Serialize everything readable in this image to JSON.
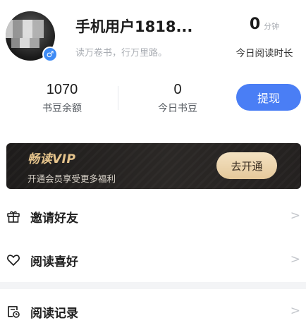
{
  "profile": {
    "username": "手机用户1818...",
    "motto": "读万卷书，行万里路。",
    "gender_icon": "male-icon",
    "gender_symbol": "♂",
    "read_time_value": "0",
    "read_time_unit": "分钟",
    "read_time_label": "今日阅读时长"
  },
  "stats": [
    {
      "value": "1070",
      "label": "书豆余额"
    },
    {
      "value": "0",
      "label": "今日书豆"
    }
  ],
  "withdraw_button": {
    "label": "提现",
    "color": "#4a7ef5"
  },
  "vip_banner": {
    "title": "畅读VIP",
    "description": "开通会员享受更多福利",
    "button_label": "去开通",
    "accent": "#e6c48c"
  },
  "menu": [
    {
      "label": "邀请好友",
      "icon": "gift-icon"
    },
    {
      "label": "阅读喜好",
      "icon": "heart-icon"
    },
    {
      "label": "阅读记录",
      "icon": "history-icon"
    }
  ],
  "arrow_glyph": ">"
}
